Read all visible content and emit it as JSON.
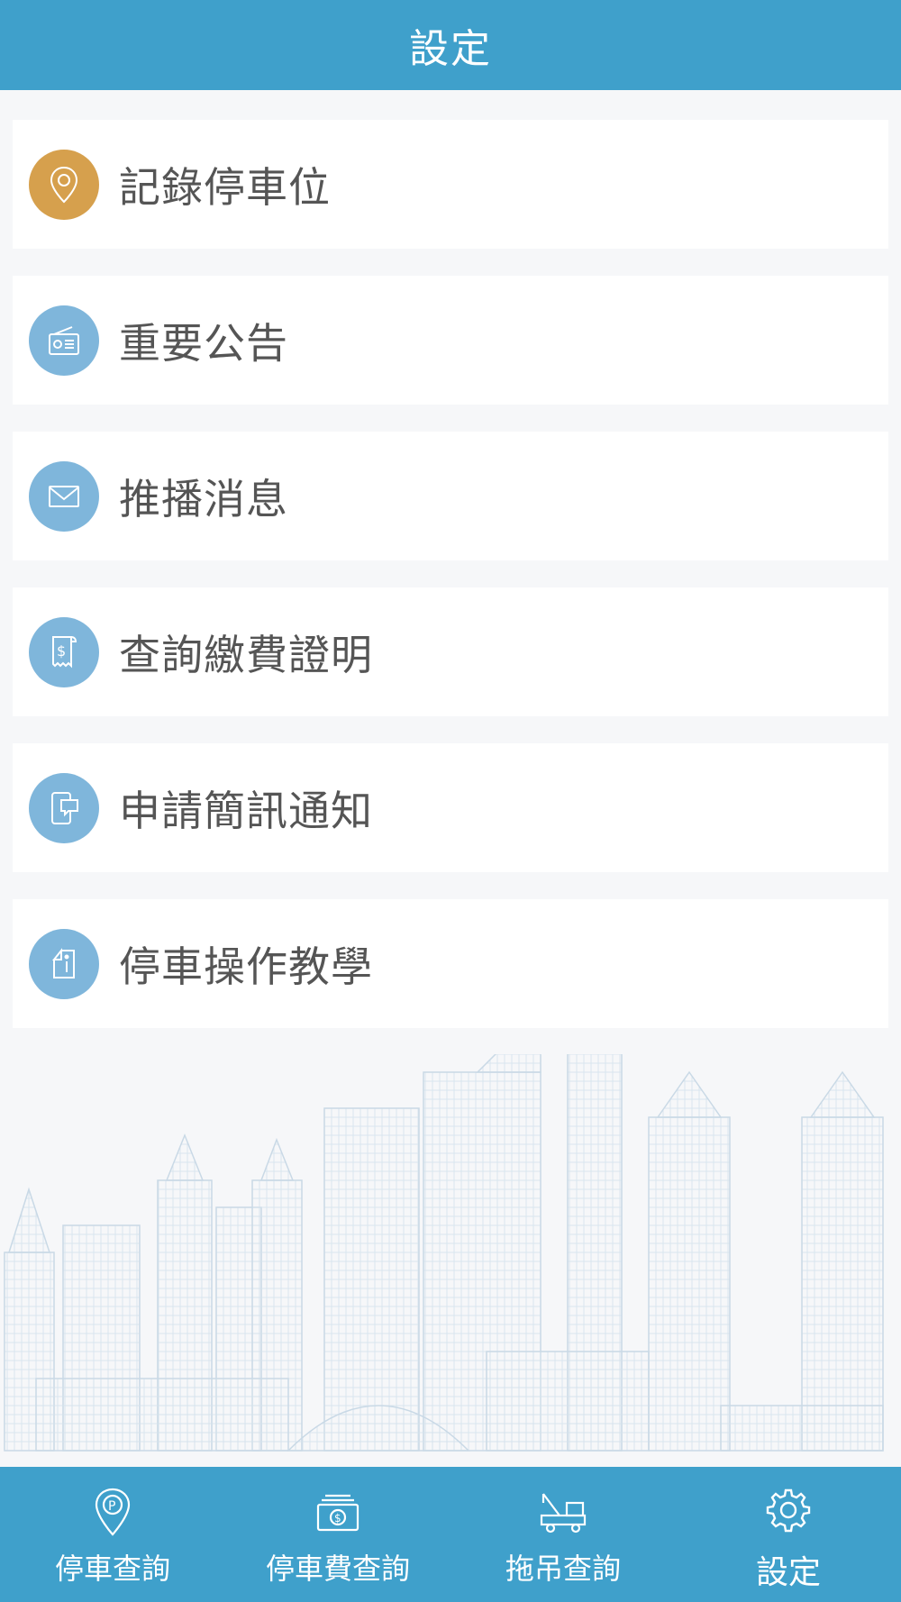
{
  "header": {
    "title": "設定"
  },
  "menu": {
    "items": [
      {
        "label": "記錄停車位",
        "icon": "location-pin-icon"
      },
      {
        "label": "重要公告",
        "icon": "radio-icon"
      },
      {
        "label": "推播消息",
        "icon": "envelope-icon"
      },
      {
        "label": "查詢繳費證明",
        "icon": "receipt-icon"
      },
      {
        "label": "申請簡訊通知",
        "icon": "phone-message-icon"
      },
      {
        "label": "停車操作教學",
        "icon": "info-booklet-icon"
      }
    ]
  },
  "tabbar": {
    "tabs": [
      {
        "label": "停車查詢",
        "icon": "parking-pin-icon"
      },
      {
        "label": "停車費查詢",
        "icon": "money-icon"
      },
      {
        "label": "拖吊查詢",
        "icon": "tow-truck-icon"
      },
      {
        "label": "設定",
        "icon": "gear-icon",
        "active": true
      }
    ]
  },
  "colors": {
    "primary": "#3fa0cb",
    "icon_blue": "#7fb6db",
    "icon_gold": "#d6a04d",
    "background": "#f6f7f9"
  }
}
